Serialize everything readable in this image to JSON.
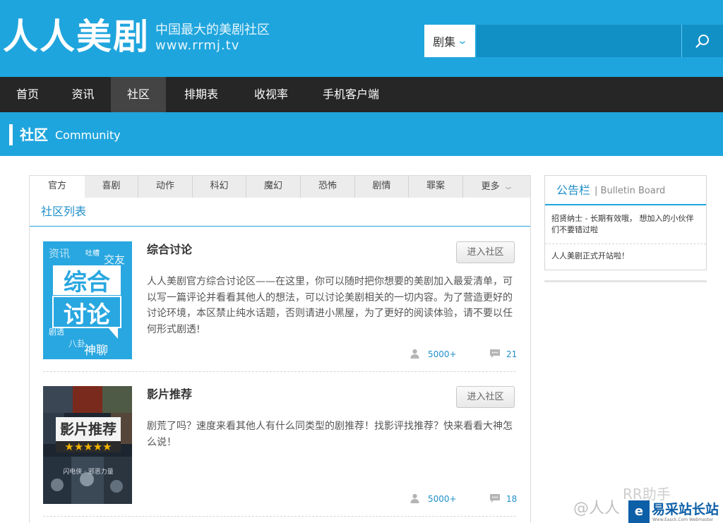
{
  "header": {
    "logo_text": "人人美剧",
    "slogan": "中国最大的美剧社区",
    "url": "www.rrmj.tv",
    "search": {
      "category": "剧集",
      "placeholder": ""
    }
  },
  "nav": {
    "items": [
      "首页",
      "资讯",
      "社区",
      "排期表",
      "收视率",
      "手机客户端"
    ],
    "active": "社区"
  },
  "band": {
    "title": "社区",
    "subtitle": "Community"
  },
  "tabs": [
    "官方",
    "喜剧",
    "动作",
    "科幻",
    "魔幻",
    "恐怖",
    "剧情",
    "罪案",
    "更多"
  ],
  "active_tab": "官方",
  "list_title": "社区列表",
  "communities": [
    {
      "title": "综合讨论",
      "enter_label": "进入社区",
      "description": "人人美剧官方综合讨论区——在这里，你可以随时把你想要的美剧加入最爱清单，可以写一篇评论并看看其他人的想法，可以讨论美剧相关的一切内容。为了营造更好的讨论环境，本区禁止纯水话题，否则请进小黑屋，为了更好的阅读体验，请不要以任何形式剧透!",
      "members": "5000+",
      "comments": "21",
      "thumb_words": {
        "w1": "资讯",
        "w2": "吐槽",
        "w3": "交友",
        "main1": "综合",
        "main2": "讨论",
        "w4": "剧透",
        "w5": "八卦",
        "w6": "神聊"
      }
    },
    {
      "title": "影片推荐",
      "enter_label": "进入社区",
      "description": "剧荒了吗？速度来看其他人有什么同类型的剧推荐！找影评找推荐？快来看看大神怎么说！",
      "members": "5000+",
      "comments": "18",
      "thumb_words": {
        "main": "影片推荐",
        "stars": "★★★★★",
        "sub": "闪电侠 · 邪恶力量"
      }
    }
  ],
  "bulletin": {
    "title": "公告栏",
    "separator": "|",
    "subtitle": "Bulletin Board",
    "items": [
      "招贤纳士 - 长期有效哦， 想加入的小伙伴们不要错过啦",
      "人人美剧正式开站啦！"
    ]
  },
  "watermarks": {
    "at": "@人人",
    "rr": "RR助手",
    "brand": "易采站长站",
    "brand_logo": "e",
    "brand_small": "Www.Easck.Com Webmaster"
  },
  "colors": {
    "brand_blue": "#1fa5dd",
    "nav_dark": "#262626",
    "link_blue": "#1f8fc9"
  }
}
